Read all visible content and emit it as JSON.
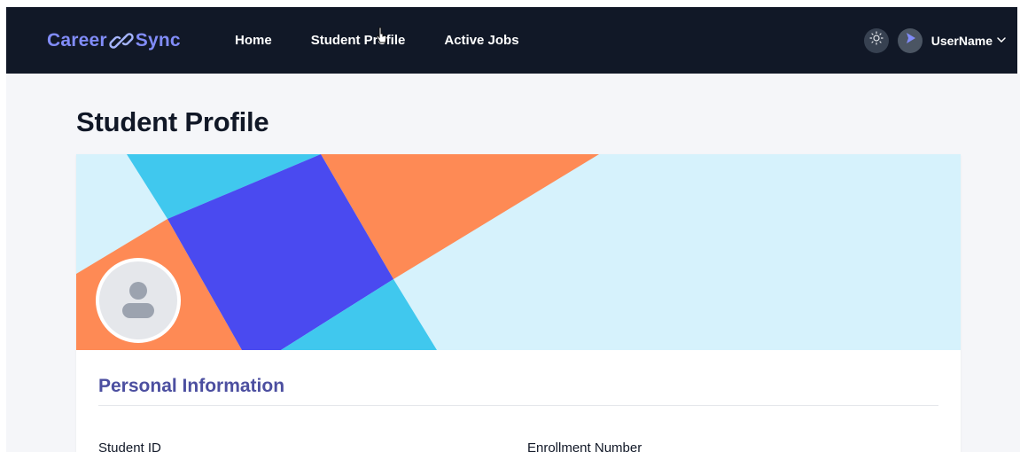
{
  "brand": {
    "name_left": "Career",
    "name_right": "Sync"
  },
  "nav": {
    "links": [
      {
        "label": "Home"
      },
      {
        "label": "Student Profile"
      },
      {
        "label": "Active Jobs"
      }
    ]
  },
  "user": {
    "name": "UserName"
  },
  "page": {
    "title": "Student Profile"
  },
  "profile": {
    "section_title": "Personal Information",
    "fields": [
      {
        "label": "Student ID"
      },
      {
        "label": "Enrollment Number"
      }
    ]
  },
  "colors": {
    "navbar": "#111827",
    "brand_accent": "#818cf8",
    "section_title": "#4c4fa0",
    "banner_orange": "#fe8a55",
    "banner_blue": "#4a4af0",
    "banner_cyan": "#40c8ee",
    "banner_light": "#d6f2fc"
  },
  "icons": {
    "brand": "link-icon",
    "theme": "sun-icon",
    "avatar": "play-icon",
    "dropdown": "chevron-down-icon",
    "profile": "user-silhouette-icon"
  }
}
